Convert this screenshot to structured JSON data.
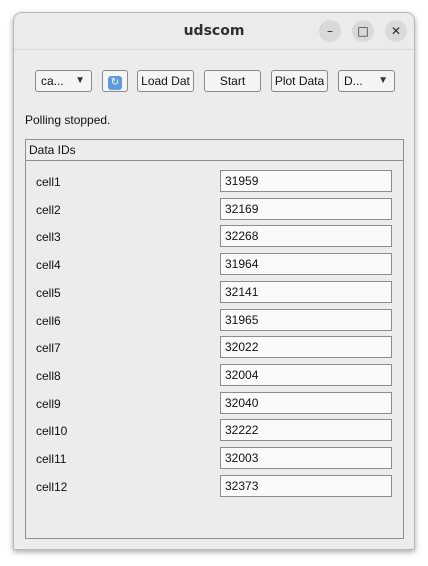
{
  "window": {
    "title": "udscom",
    "min_glyph": "–",
    "max_glyph": "□",
    "close_glyph": "✕"
  },
  "toolbar": {
    "combo1": {
      "value": "ca...",
      "arrow": "▼"
    },
    "refresh_icon": "refresh-icon",
    "refresh_glyph": "↻",
    "load_label": "Load Dat",
    "start_label": "Start",
    "plot_label": "Plot Data",
    "combo2": {
      "value": "D...",
      "arrow": "▼"
    }
  },
  "status": "Polling stopped.",
  "data_ids": {
    "title": "Data IDs",
    "rows": [
      {
        "label": "cell1",
        "value": "31959"
      },
      {
        "label": "cell2",
        "value": "32169"
      },
      {
        "label": "cell3",
        "value": "32268"
      },
      {
        "label": "cell4",
        "value": "31964"
      },
      {
        "label": "cell5",
        "value": "32141"
      },
      {
        "label": "cell6",
        "value": "31965"
      },
      {
        "label": "cell7",
        "value": "32022"
      },
      {
        "label": "cell8",
        "value": "32004"
      },
      {
        "label": "cell9",
        "value": "32040"
      },
      {
        "label": "cell10",
        "value": "32222"
      },
      {
        "label": "cell11",
        "value": "32003"
      },
      {
        "label": "cell12",
        "value": "32373"
      }
    ]
  }
}
